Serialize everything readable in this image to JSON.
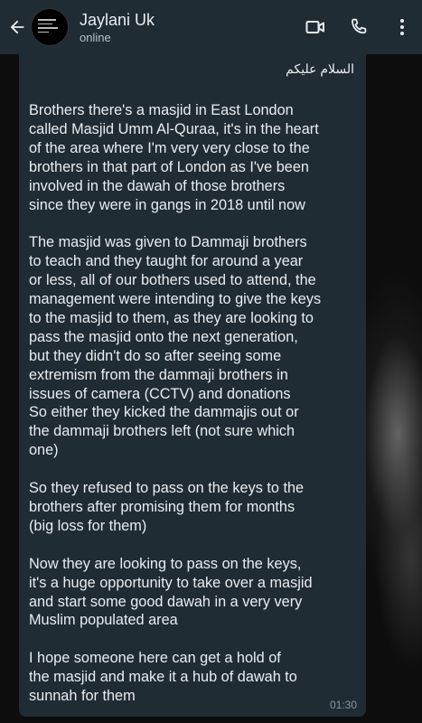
{
  "header": {
    "contact_name": "Jaylani Uk",
    "status": "online",
    "icons": [
      "back-arrow-icon",
      "video-call-icon",
      "phone-icon",
      "more-vert-icon"
    ]
  },
  "message": {
    "greeting": "السلام عليكم",
    "paragraphs": [
      "Brothers there's a masjid in East London\ncalled Masjid Umm Al-Quraa, it's in the heart\nof the area where I'm very very close to the\nbrothers in that part of London as I've been\ninvolved in the dawah of those brothers\nsince they were in gangs in 2018 until now",
      "The masjid was given to Dammaji brothers\nto teach and they taught for around a year\nor less, all of our bothers used to attend, the\nmanagement were intending to give the keys\nto the masjid to them, as they are looking to\npass the masjid onto the next generation,\nbut they didn't do so after seeing some\nextremism from the dammaji brothers in\nissues of camera (CCTV) and donations\nSo either they kicked the dammajis out or\nthe dammaji brothers left (not sure which\none)",
      "So they refused to pass on the keys to the\nbrothers after promising them for months\n(big loss for them)",
      "Now they are looking to pass on the keys,\nit's a huge opportunity to take over a masjid\nand start some good dawah in a very very\nMuslim populated area",
      "I hope someone here can get a hold of\nthe masjid and make it a hub of dawah to\nsunnah for them"
    ],
    "time": "01:30"
  },
  "colors": {
    "header_bg": "#1f2c33",
    "bubble_bg": "#1f2c33",
    "text": "#e9edef",
    "meta_text": "#8696a0"
  }
}
